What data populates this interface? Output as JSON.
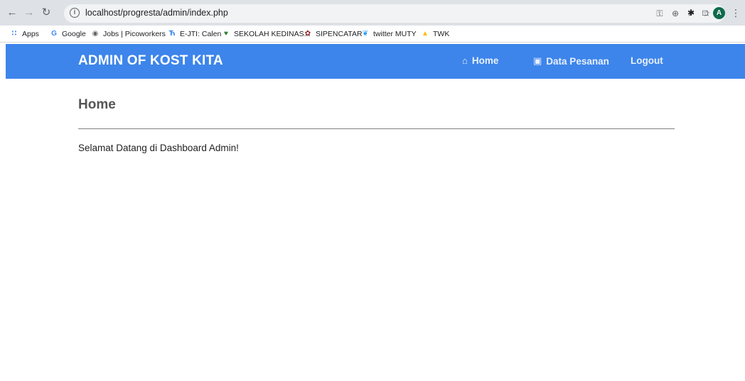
{
  "browser": {
    "url": "localhost/progresta/admin/index.php",
    "avatar_letter": "A",
    "bookmarks": [
      {
        "label": "Apps",
        "icon": "apps-grid-icon",
        "color": "#4285f4"
      },
      {
        "label": "Google",
        "icon": "google-icon",
        "color": "#4285f4"
      },
      {
        "label": "Jobs | Picoworkers",
        "icon": "globe-icon",
        "color": "#5f6368"
      },
      {
        "label": "E-JTI: Calen",
        "icon": "ejti-icon",
        "color": "#1a73e8"
      },
      {
        "label": "SEKOLAH KEDINAS...",
        "icon": "emblem-icon",
        "color": "#2e7d32"
      },
      {
        "label": "SIPENCATAR",
        "icon": "sipencatar-icon",
        "color": "#8b1a1a"
      },
      {
        "label": "twitter MUTY",
        "icon": "twitter-icon",
        "color": "#1d9bf0"
      },
      {
        "label": "TWK",
        "icon": "drive-icon",
        "color": "#fbbc04"
      }
    ]
  },
  "navbar": {
    "brand": "ADMIN OF KOST KITA",
    "links": [
      {
        "label": "Home",
        "icon": "home-icon"
      },
      {
        "label": "Data Pesanan",
        "icon": "book-icon"
      },
      {
        "label": "Logout"
      }
    ],
    "color": "#3d85eb"
  },
  "main": {
    "title": "Home",
    "welcome": "Selamat Datang di Dashboard Admin!"
  }
}
